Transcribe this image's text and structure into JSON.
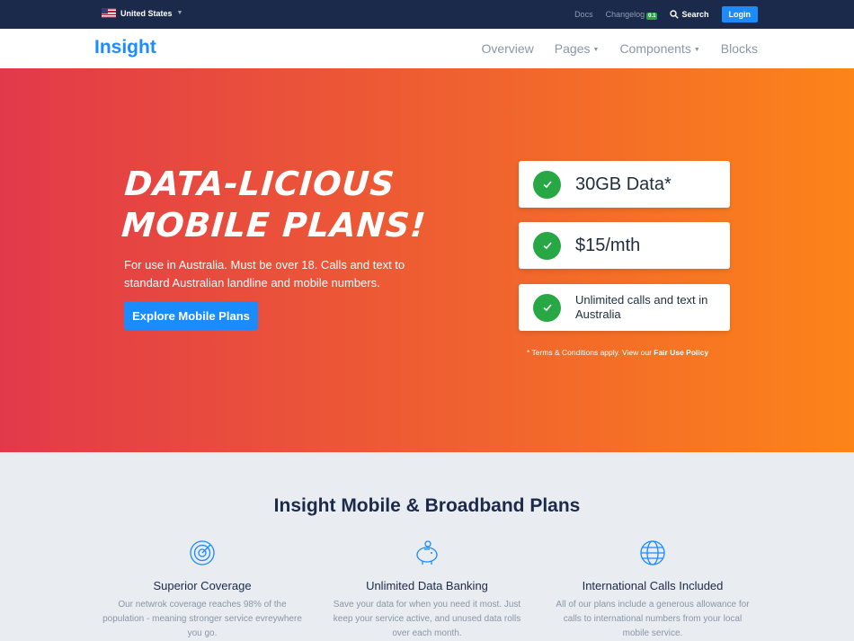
{
  "topbar": {
    "country": "United States",
    "links": {
      "docs": "Docs",
      "changelog": "Changelog",
      "changelog_badge": "0.1",
      "search": "Search"
    },
    "login_label": "Login"
  },
  "navbar": {
    "brand": "Insight",
    "items": [
      "Overview",
      "Pages",
      "Components",
      "Blocks"
    ]
  },
  "hero": {
    "title_line1": "Data-licious",
    "title_line2": "mobile plans!",
    "subtitle": "For use in Australia. Must be over 18. Calls and text to standard Australian landline and mobile numbers.",
    "cta_label": "Explore Mobile Plans",
    "features": [
      "30GB Data*",
      "$15/mth",
      "Unlimited calls and text in Australia"
    ],
    "terms_text": "* Terms & Conditions apply. View our ",
    "terms_link": "Fair Use Policy"
  },
  "plans": {
    "title": "Insight Mobile & Broadband Plans",
    "items": [
      {
        "title": "Superior Coverage",
        "text": "Our netwrok coverage reaches 98% of the population - meaning stronger service evreywhere you go.",
        "icon": "target-icon"
      },
      {
        "title": "Unlimited Data Banking",
        "text": "Save your data for when you need it most. Just keep your service active, and unused data rolls over each month.",
        "icon": "piggy-bank-icon"
      },
      {
        "title": "International Calls Included",
        "text": "All of our plans include a generous allowance for calls to international numbers from your local mobile service.",
        "icon": "globe-icon"
      }
    ]
  },
  "colors": {
    "accent": "#1a8cff",
    "success": "#28a745",
    "topbar": "#1b2a4a",
    "hero_start": "#e2394a",
    "hero_end": "#fc8419"
  }
}
